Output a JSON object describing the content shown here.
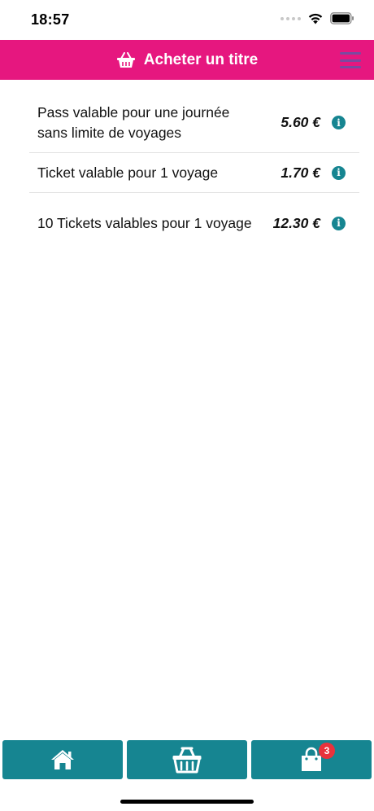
{
  "status": {
    "time": "18:57"
  },
  "header": {
    "title": "Acheter un titre",
    "icon": "basket-icon"
  },
  "products": [
    {
      "label": "Pass valable pour une journée sans limite de voyages",
      "price": "5.60 €"
    },
    {
      "label": "Ticket valable pour 1 voyage",
      "price": "1.70 €"
    },
    {
      "label": "10 Tickets valables pour 1 voyage",
      "price": "12.30 €"
    }
  ],
  "bottom_nav": {
    "home_icon": "home-icon",
    "shop_icon": "basket-icon",
    "cart_icon": "shopping-bag-icon",
    "cart_count": "3"
  },
  "colors": {
    "header": "#e6177f",
    "accent": "#168591",
    "badge": "#e8323c"
  }
}
